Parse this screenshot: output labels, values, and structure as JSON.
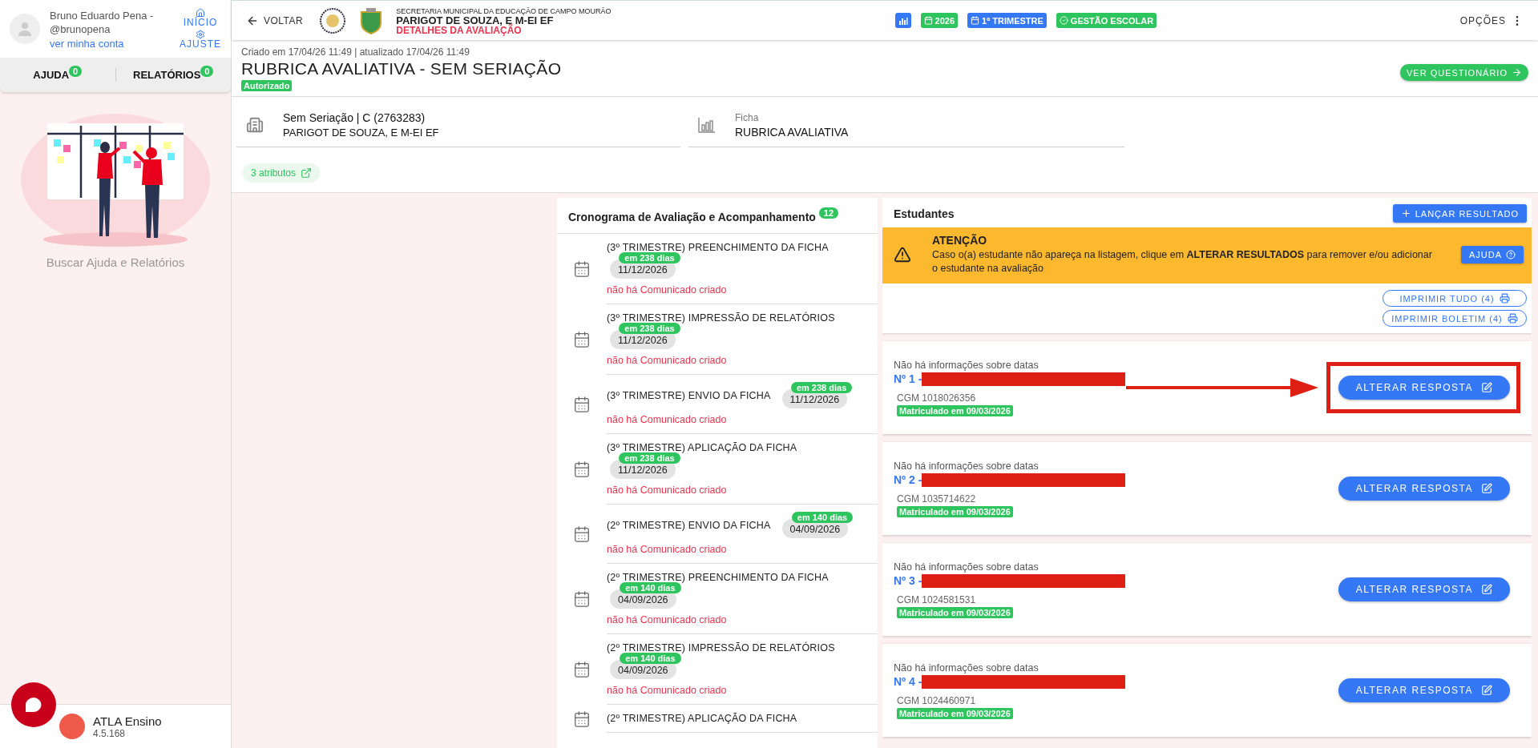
{
  "sidebar": {
    "user": {
      "name": "Bruno Eduardo Pena - @brunopena",
      "link": "ver minha conta"
    },
    "nav": [
      {
        "kind": "home",
        "label": "INÍCIO"
      },
      {
        "kind": "settings",
        "label": "AJUSTE"
      }
    ],
    "tabs": [
      {
        "label": "AJUDA",
        "count": "0"
      },
      {
        "label": "RELATÓRIOS",
        "count": "0"
      }
    ],
    "empty_text": "Buscar Ajuda e Relatórios",
    "footer": {
      "app": "ATLA Ensino",
      "version": "4.5.168"
    }
  },
  "topbar": {
    "back": "VOLTAR",
    "org": "SECRETARIA MUNICIPAL DA EDUCAÇÃO DE CAMPO MOURÃO",
    "school": "PARIGOT DE SOUZA, E M-EI EF",
    "page": "DETALHES DA AVALIAÇÃO",
    "chips": [
      {
        "kind": "chart",
        "color": "#3478f6"
      },
      {
        "kind": "calendar",
        "label": "2026",
        "color": "#2ec55e"
      },
      {
        "kind": "calendar",
        "label": "1º TRIMESTRE",
        "color": "#3478f6"
      },
      {
        "kind": "check",
        "label": "GESTÃO ESCOLAR",
        "color": "#2ec55e"
      }
    ],
    "options": "OPÇÕES"
  },
  "header": {
    "meta": "Criado em 17/04/26 11:49 | atualizado 17/04/26 11:49",
    "title": "RUBRICA AVALIATIVA - SEM SERIAÇÃO",
    "status": "Autorizado",
    "action": "VER QUESTIONÁRIO"
  },
  "info": [
    {
      "kind": "class",
      "value": "Sem Seriação | C (2763283)",
      "detail": "PARIGOT DE SOUZA, E M-EI EF"
    },
    {
      "kind": "form",
      "label": "Ficha",
      "value": "RUBRICA AVALIATIVA"
    }
  ],
  "attributes": "3 atributos",
  "schedule": {
    "title": "Cronograma de Avaliação e Acompanhamento",
    "count": "12",
    "items": [
      {
        "kind": "stacked",
        "title": "(3º TRIMESTRE) PREENCHIMENTO DA FICHA",
        "due": "em 238 dias",
        "date": "11/12/2026",
        "notice": "não há Comunicado criado"
      },
      {
        "kind": "stacked",
        "title": "(3º TRIMESTRE) IMPRESSÃO DE RELATÓRIOS",
        "due": "em 238 dias",
        "date": "11/12/2026",
        "notice": "não há Comunicado criado"
      },
      {
        "kind": "inline",
        "title": "(3º TRIMESTRE) ENVIO DA FICHA",
        "due": "em 238 dias",
        "date": "11/12/2026",
        "notice": "não há Comunicado criado"
      },
      {
        "kind": "stacked",
        "title": "(3º TRIMESTRE) APLICAÇÃO DA FICHA",
        "due": "em 238 dias",
        "date": "11/12/2026",
        "notice": "não há Comunicado criado"
      },
      {
        "kind": "inline",
        "title": "(2º TRIMESTRE) ENVIO DA FICHA",
        "due": "em 140 dias",
        "date": "04/09/2026",
        "notice": "não há Comunicado criado"
      },
      {
        "kind": "stacked",
        "title": "(2º TRIMESTRE) PREENCHIMENTO DA FICHA",
        "due": "em 140 dias",
        "date": "04/09/2026",
        "notice": "não há Comunicado criado"
      },
      {
        "kind": "stacked",
        "title": "(2º TRIMESTRE) IMPRESSÃO DE RELATÓRIOS",
        "due": "em 140 dias",
        "date": "04/09/2026",
        "notice": "não há Comunicado criado"
      },
      {
        "kind": "stacked",
        "title": "(2º TRIMESTRE) APLICAÇÃO DA FICHA"
      }
    ]
  },
  "students": {
    "title": "Estudantes",
    "add": "LANÇAR RESULTADO",
    "alert": {
      "title": "ATENÇÃO",
      "text": "Caso o(a) estudante não apareça na listagem, clique em **ALTERAR RESULTADOS** para remover e/ou adicionar o estudante na avaliação",
      "help": "AJUDA"
    },
    "prints": [
      "IMPRIMIR TUDO (4)",
      "IMPRIMIR BOLETIM (4)"
    ],
    "items": [
      {
        "dates": "Não há informações sobre datas",
        "number": "Nº 1 -",
        "cgm": "CGM 1018026356",
        "enrolled": "Matriculado em 09/03/2026",
        "action": "ALTERAR RESPOSTA",
        "highlighted": true
      },
      {
        "dates": "Não há informações sobre datas",
        "number": "Nº 2 -",
        "cgm": "CGM 1035714622",
        "enrolled": "Matriculado em 09/03/2026",
        "action": "ALTERAR RESPOSTA",
        "highlighted": false
      },
      {
        "dates": "Não há informações sobre datas",
        "number": "Nº 3 -",
        "cgm": "CGM 1024581531",
        "enrolled": "Matriculado em 09/03/2026",
        "action": "ALTERAR RESPOSTA",
        "highlighted": false
      },
      {
        "dates": "Não há informações sobre datas",
        "number": "Nº 4 -",
        "cgm": "CGM 1024460971",
        "enrolled": "Matriculado em 09/03/2026",
        "action": "ALTERAR RESPOSTA",
        "highlighted": false
      }
    ]
  }
}
